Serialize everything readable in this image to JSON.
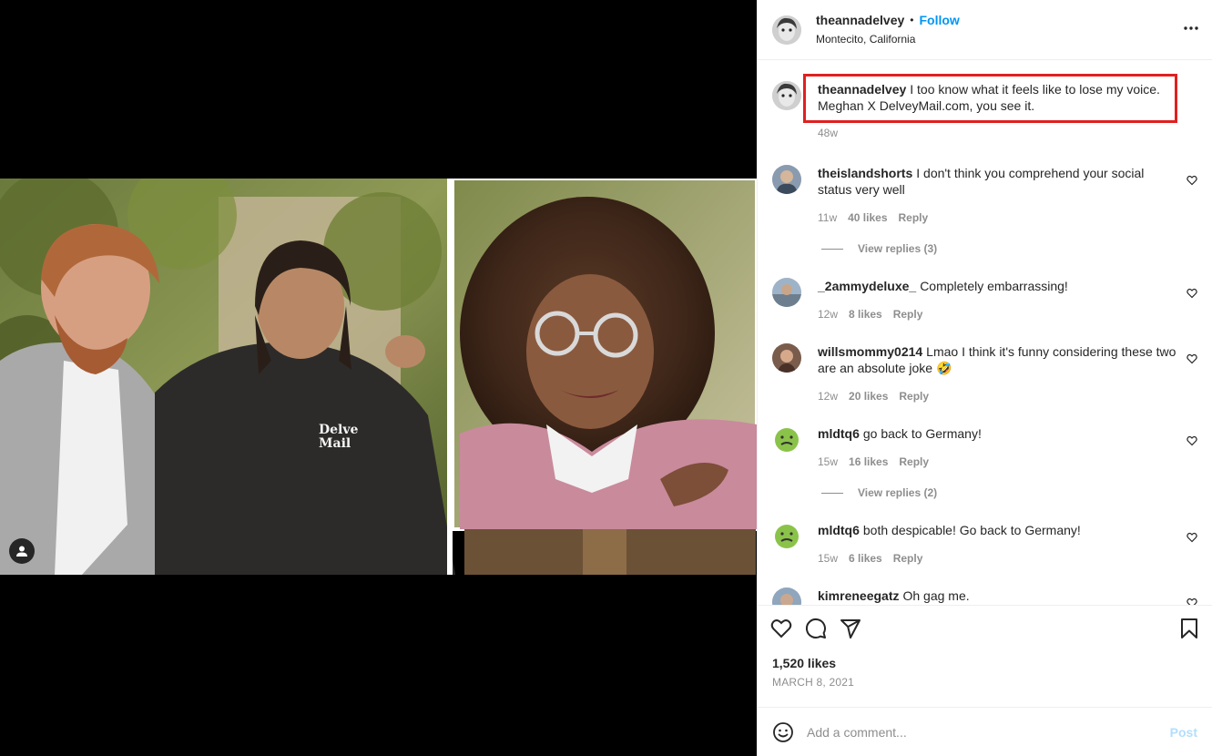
{
  "header": {
    "username": "theannadelvey",
    "dot": "•",
    "follow_label": "Follow",
    "location": "Montecito, California"
  },
  "caption": {
    "username": "theannadelvey",
    "text": "I too know what it feels like to lose my voice. Meghan X DelveyMail.com, you see it.",
    "age": "48w"
  },
  "comments": [
    {
      "username": "theislandshorts",
      "text": "I don't think you comprehend your social status very well",
      "age": "11w",
      "likes": "40 likes",
      "reply": "Reply",
      "view_replies": "View replies (3)"
    },
    {
      "username": "_2ammydeluxe_",
      "text": "Completely embarrassing!",
      "age": "12w",
      "likes": "8 likes",
      "reply": "Reply"
    },
    {
      "username": "willsmommy0214",
      "text": "Lmao I think it's funny considering these two are an absolute joke 🤣",
      "age": "12w",
      "likes": "20 likes",
      "reply": "Reply"
    },
    {
      "username": "mldtq6",
      "text": "go back to Germany!",
      "age": "15w",
      "likes": "16 likes",
      "reply": "Reply",
      "view_replies": "View replies (2)"
    },
    {
      "username": "mldtq6",
      "text": "both despicable! Go back to Germany!",
      "age": "15w",
      "likes": "6 likes",
      "reply": "Reply"
    },
    {
      "username": "kimreneegatz",
      "text": "Oh gag me."
    }
  ],
  "image_text": {
    "hoodie_line1": "Delve",
    "hoodie_line2": "Mail"
  },
  "stats": {
    "likes": "1,520 likes",
    "date": "MARCH 8, 2021"
  },
  "add_comment": {
    "placeholder": "Add a comment...",
    "post_label": "Post"
  },
  "icons": [
    "heart-icon",
    "comment-icon",
    "share-icon",
    "bookmark-icon",
    "more-icon",
    "emoji-icon",
    "user-tag-icon"
  ],
  "colors": {
    "accent": "#0095f6",
    "highlight_box": "#e02020",
    "muted": "#8e8e8e"
  }
}
